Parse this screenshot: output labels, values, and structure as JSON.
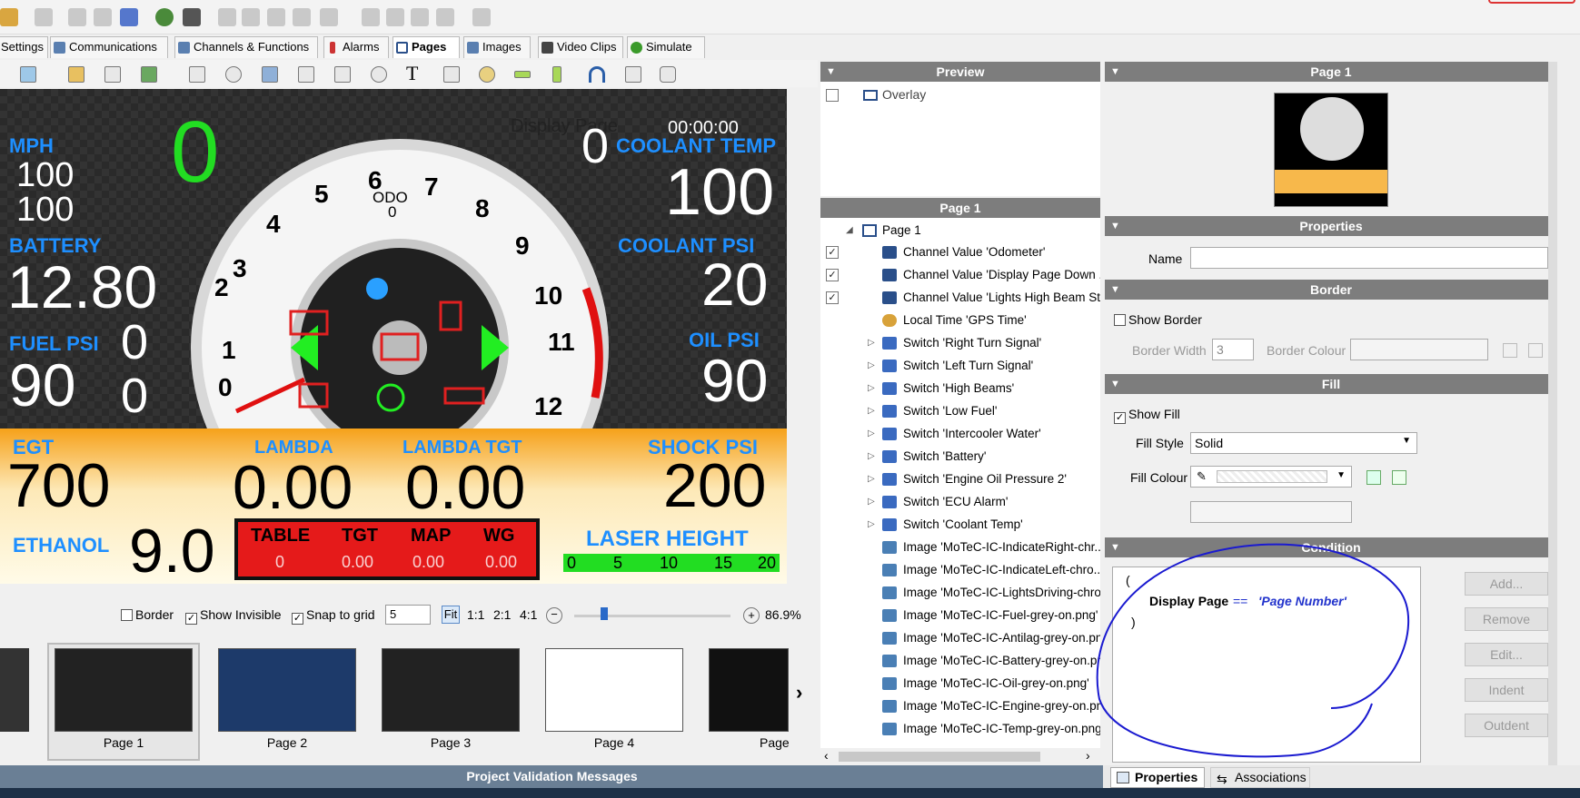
{
  "tabs": [
    {
      "label": "Settings",
      "active": false
    },
    {
      "label": "Communications",
      "active": false
    },
    {
      "label": "Channels & Functions",
      "active": false
    },
    {
      "label": "Alarms",
      "active": false
    },
    {
      "label": "Pages",
      "active": true
    },
    {
      "label": "Images",
      "active": false
    },
    {
      "label": "Video Clips",
      "active": false
    },
    {
      "label": "Simulate",
      "active": false
    }
  ],
  "dashboard": {
    "mph_label": "MPH",
    "mph_v1": "100",
    "mph_v2": "100",
    "gear": "0",
    "display_page_label": "Display Page",
    "time": "00:00:00",
    "gear_right": "0",
    "coolant_temp_label": "COOLANT TEMP",
    "coolant_temp": "100",
    "battery_label": "BATTERY",
    "battery": "12.80",
    "coolant_psi_label": "COOLANT PSI",
    "coolant_psi": "20",
    "fuel_psi_label": "FUEL PSI",
    "fuel_psi_a": "0",
    "fuel_psi_b": "90",
    "fuel_psi_c": "0",
    "oil_psi_label": "OIL PSI",
    "oil_psi": "90",
    "odo_label": "ODO",
    "odo": "0",
    "ticks": [
      "0",
      "1",
      "2",
      "3",
      "4",
      "5",
      "6",
      "7",
      "8",
      "9",
      "10",
      "11",
      "12"
    ],
    "egt_label": "EGT",
    "egt": "700",
    "lambda_label": "LAMBDA",
    "lambda": "0.00",
    "lambda_tgt_label": "LAMBDA TGT",
    "lambda_tgt": "0.00",
    "shock_psi_label": "SHOCK PSI",
    "shock_psi": "200",
    "ethanol_label": "ETHANOL",
    "ethanol": "9.0",
    "table_headers": [
      "TABLE",
      "TGT",
      "MAP",
      "WG"
    ],
    "table_values": [
      "0",
      "0.00",
      "0.00",
      "0.00"
    ],
    "laser_label": "LASER HEIGHT",
    "laser_ticks": [
      "0",
      "5",
      "10",
      "15",
      "20"
    ]
  },
  "display_options": {
    "border": "Border",
    "border_checked": false,
    "show_invisible": "Show Invisible",
    "show_invisible_checked": true,
    "snap": "Snap to grid",
    "snap_checked": true,
    "grid": "5",
    "fit": "Fit",
    "z11": "1:1",
    "z21": "2:1",
    "z41": "4:1",
    "zoom": "86.9%"
  },
  "thumbnails": [
    {
      "label": "Page 1"
    },
    {
      "label": "Page 2"
    },
    {
      "label": "Page 3"
    },
    {
      "label": "Page 4"
    },
    {
      "label": "Page"
    }
  ],
  "validation_bar": "Project Validation Messages",
  "preview": {
    "title": "Preview",
    "overlay": "Overlay"
  },
  "tree": {
    "title": "Page 1",
    "root": "Page 1",
    "items": [
      {
        "label": "Channel Value 'Odometer'",
        "check": "✓",
        "expand": "",
        "icon": "channel-value-icon"
      },
      {
        "label": "Channel Value 'Display Page Down ...",
        "check": "✓",
        "expand": "",
        "icon": "channel-value-icon"
      },
      {
        "label": "Channel Value 'Lights High Beam St...",
        "check": "✓",
        "expand": "",
        "icon": "channel-value-icon"
      },
      {
        "label": "Local Time 'GPS Time'",
        "check": "",
        "expand": "",
        "icon": "local-time-icon"
      },
      {
        "label": "Switch 'Right Turn Signal'",
        "check": "",
        "expand": "▷",
        "icon": "switch-icon"
      },
      {
        "label": "Switch 'Left Turn Signal'",
        "check": "",
        "expand": "▷",
        "icon": "switch-icon"
      },
      {
        "label": "Switch 'High Beams'",
        "check": "",
        "expand": "▷",
        "icon": "switch-icon"
      },
      {
        "label": "Switch 'Low Fuel'",
        "check": "",
        "expand": "▷",
        "icon": "switch-icon"
      },
      {
        "label": "Switch 'Intercooler Water'",
        "check": "",
        "expand": "▷",
        "icon": "switch-icon"
      },
      {
        "label": "Switch 'Battery'",
        "check": "",
        "expand": "▷",
        "icon": "switch-icon"
      },
      {
        "label": "Switch 'Engine Oil Pressure 2'",
        "check": "",
        "expand": "▷",
        "icon": "switch-icon"
      },
      {
        "label": "Switch 'ECU Alarm'",
        "check": "",
        "expand": "▷",
        "icon": "switch-icon"
      },
      {
        "label": "Switch 'Coolant Temp'",
        "check": "",
        "expand": "▷",
        "icon": "switch-icon"
      },
      {
        "label": "Image 'MoTeC-IC-IndicateRight-chr...",
        "check": "",
        "expand": "",
        "icon": "image-icon"
      },
      {
        "label": "Image 'MoTeC-IC-IndicateLeft-chro...",
        "check": "",
        "expand": "",
        "icon": "image-icon"
      },
      {
        "label": "Image 'MoTeC-IC-LightsDriving-chro...",
        "check": "",
        "expand": "",
        "icon": "image-icon"
      },
      {
        "label": "Image 'MoTeC-IC-Fuel-grey-on.png'",
        "check": "",
        "expand": "",
        "icon": "image-icon"
      },
      {
        "label": "Image 'MoTeC-IC-Antilag-grey-on.png'",
        "check": "",
        "expand": "",
        "icon": "image-icon"
      },
      {
        "label": "Image 'MoTeC-IC-Battery-grey-on.png'",
        "check": "",
        "expand": "",
        "icon": "image-icon"
      },
      {
        "label": "Image 'MoTeC-IC-Oil-grey-on.png'",
        "check": "",
        "expand": "",
        "icon": "image-icon"
      },
      {
        "label": "Image 'MoTeC-IC-Engine-grey-on.png'",
        "check": "",
        "expand": "",
        "icon": "image-icon"
      },
      {
        "label": "Image 'MoTeC-IC-Temp-grey-on.png'",
        "check": "",
        "expand": "",
        "icon": "image-icon"
      }
    ]
  },
  "props": {
    "page_title": "Page 1",
    "properties_title": "Properties",
    "name_label": "Name",
    "name_value": "",
    "border_title": "Border",
    "show_border": "Show Border",
    "show_border_checked": false,
    "border_width_label": "Border Width",
    "border_width": "3",
    "border_colour_label": "Border Colour",
    "fill_title": "Fill",
    "show_fill": "Show Fill",
    "show_fill_checked": true,
    "fill_style_label": "Fill Style",
    "fill_style": "Solid",
    "fill_colour_label": "Fill Colour",
    "condition_title": "Condition",
    "cond_open": "(",
    "cond_var": "Display Page",
    "cond_op": "==",
    "cond_val": "'Page Number'",
    "cond_close": ")",
    "buttons": [
      "Add...",
      "Remove",
      "Edit...",
      "Indent",
      "Outdent"
    ]
  },
  "bottom_tabs": {
    "properties": "Properties",
    "associations": "Associations"
  },
  "colors": {
    "accent_blue": "#1e8fff",
    "gear_green": "#22dd22",
    "header_grey": "#7d7d7d",
    "annotation": "#1a1ad0"
  }
}
